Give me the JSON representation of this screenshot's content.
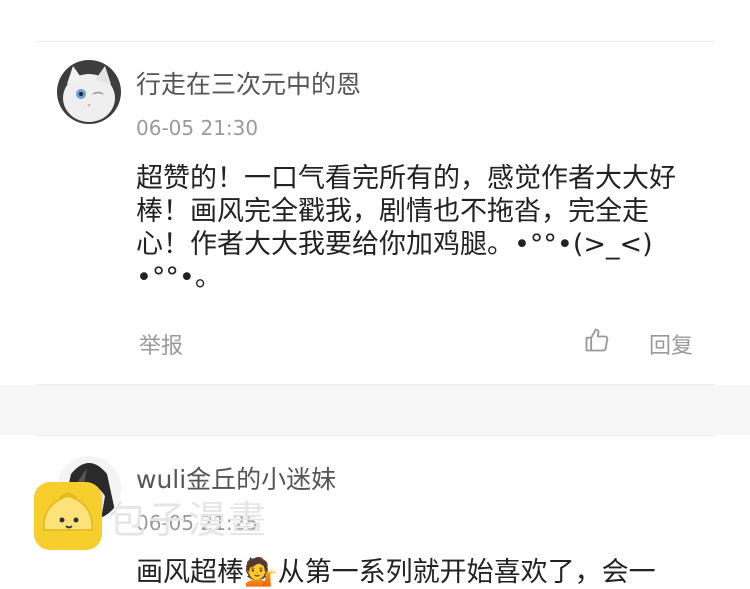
{
  "comments": [
    {
      "username": "行走在三次元中的恩",
      "time": "06-05 21:30",
      "content": "超赞的！一口气看完所有的，感觉作者大大好棒！画风完全戳我，剧情也不拖沓，完全走心！作者大大我要给你加鸡腿。•°°•(>_<)•°°•。",
      "report_label": "举报",
      "reply_label": "回复",
      "avatar_icon": "white-cat-avatar"
    },
    {
      "username": "wuli金丘的小迷妹",
      "time": "06-05 21:25",
      "content": "画风超棒💁从第一系列就开始喜欢了，会一",
      "avatar_icon": "dark-character-avatar"
    }
  ],
  "watermark": {
    "text": "包子漫畫",
    "logo_icon": "bun-logo-icon"
  },
  "icons": {
    "like": "thumbs-up-icon"
  }
}
